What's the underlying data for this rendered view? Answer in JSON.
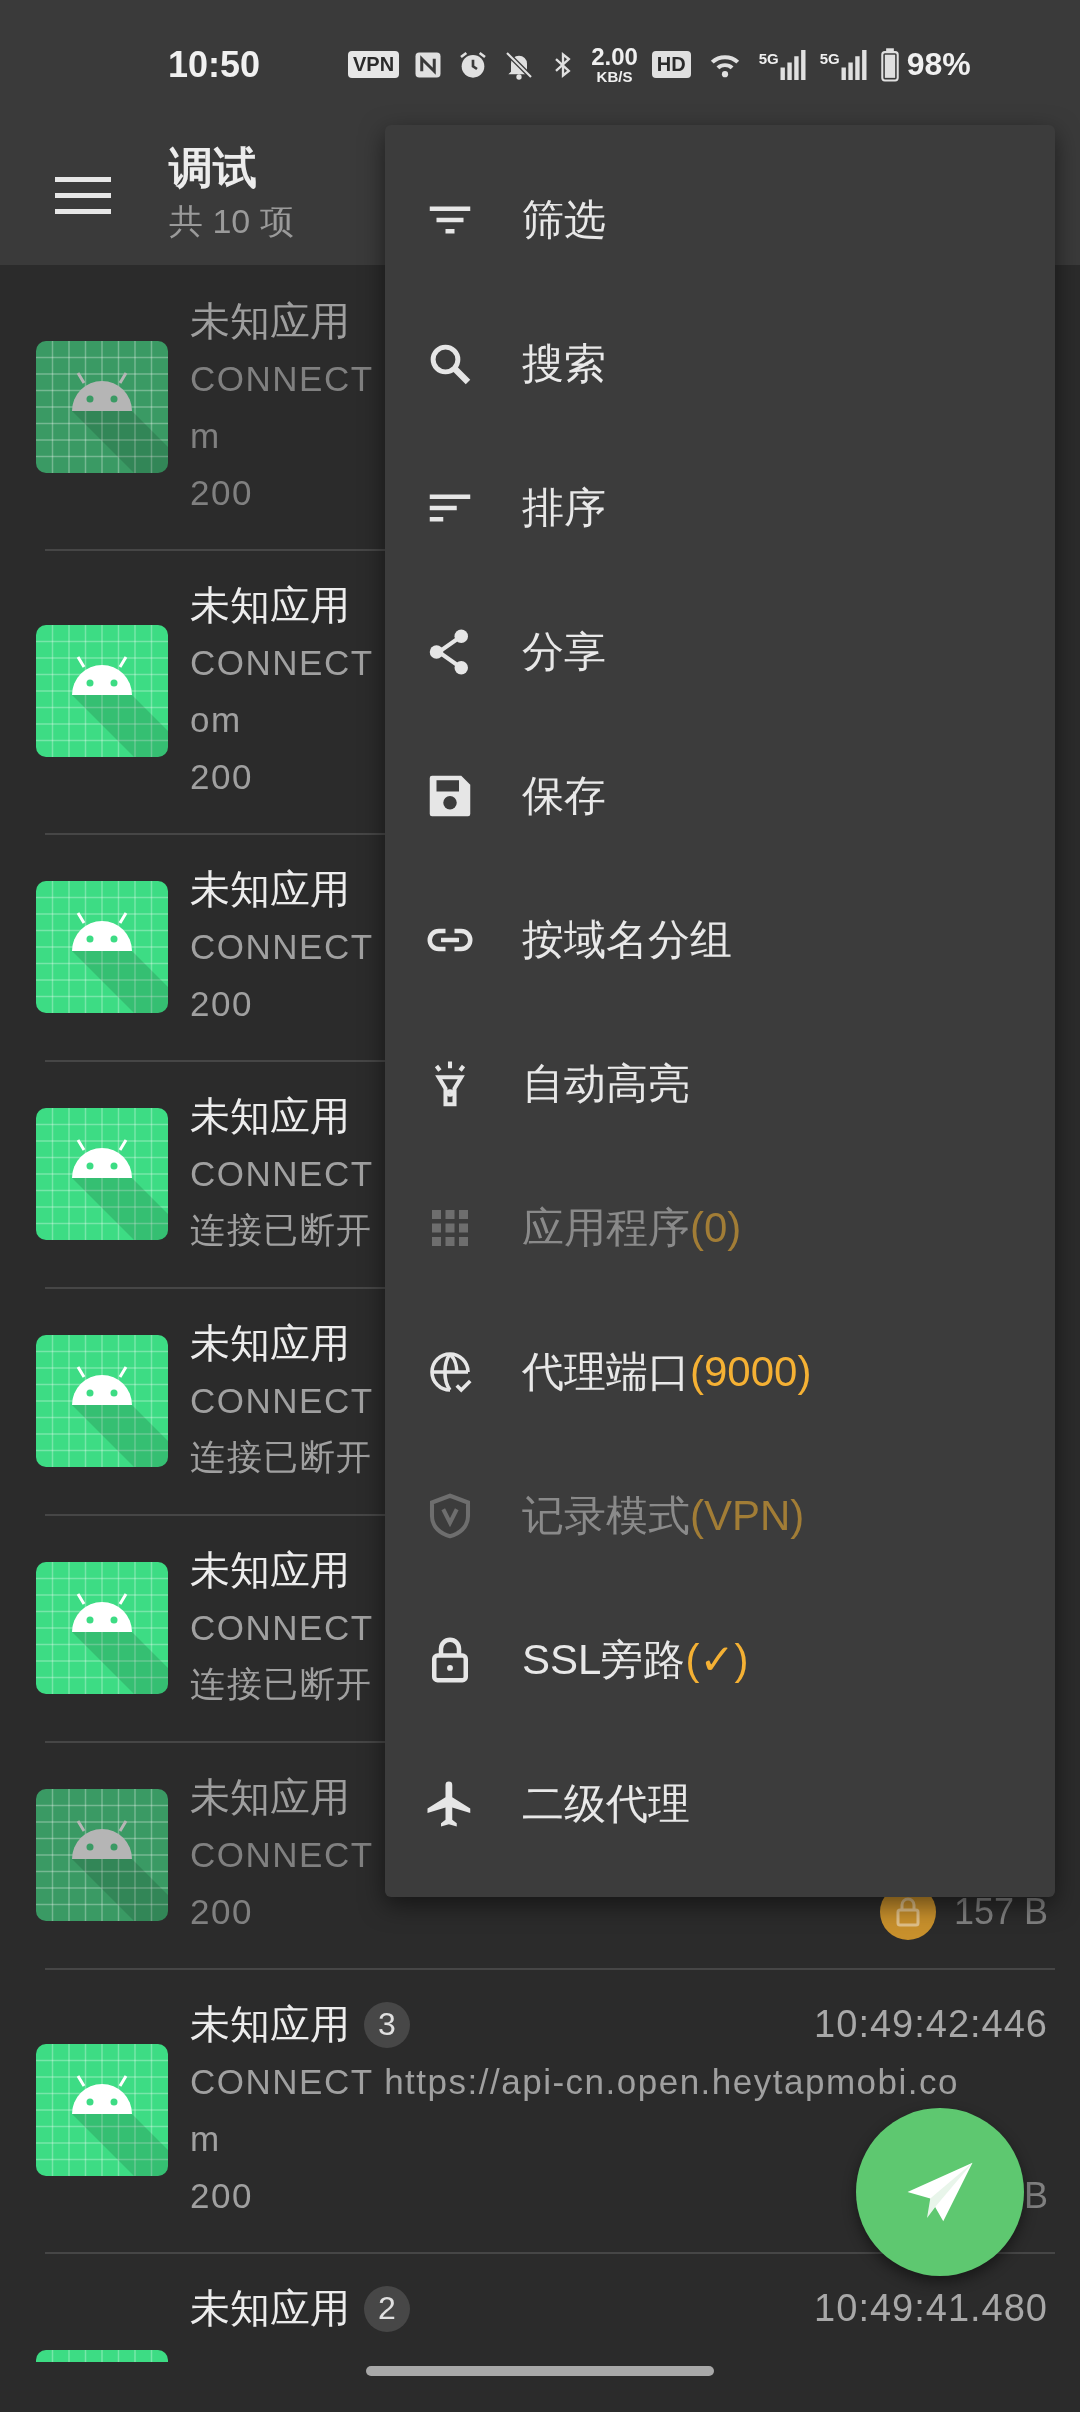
{
  "status_bar": {
    "time": "10:50",
    "vpn": "VPN",
    "speed": "2.00",
    "speed_unit": "KB/S",
    "hd": "HD",
    "networks": [
      "5G",
      "5G"
    ],
    "battery": "98%"
  },
  "app_bar": {
    "title": "调试",
    "subtitle": "共 10 项"
  },
  "rows": [
    {
      "title": "未知应用",
      "dimmed": true,
      "lines": [
        "CONNECT",
        "m",
        "200"
      ]
    },
    {
      "title": "未知应用",
      "dimmed": false,
      "lines": [
        "CONNECT",
        "om",
        "200"
      ]
    },
    {
      "title": "未知应用",
      "dimmed": false,
      "lines": [
        "CONNECT",
        "200"
      ]
    },
    {
      "title": "未知应用",
      "dimmed": false,
      "lines": [
        "CONNECT",
        "连接已断开"
      ]
    },
    {
      "title": "未知应用",
      "dimmed": false,
      "lines": [
        "CONNECT",
        "连接已断开"
      ]
    },
    {
      "title": "未知应用",
      "dimmed": false,
      "lines": [
        "CONNECT",
        "连接已断开"
      ]
    },
    {
      "title": "未知应用",
      "dimmed": true,
      "locked": true,
      "lines": [
        "CONNECT",
        "200"
      ],
      "size": "157 B"
    },
    {
      "title": "未知应用",
      "dimmed": false,
      "badge": "3",
      "time": "10:49:42:446",
      "lines": [
        "CONNECT https://api-cn.open.heytapmobi.co",
        "m",
        "200"
      ],
      "size": "B"
    },
    {
      "title": "未知应用",
      "dimmed": false,
      "badge": "2",
      "time": "10:49:41.480",
      "lines": []
    }
  ],
  "menu": [
    {
      "label": "筛选",
      "disabled": false
    },
    {
      "label": "搜索",
      "disabled": false
    },
    {
      "label": "排序",
      "disabled": false
    },
    {
      "label": "分享",
      "disabled": false
    },
    {
      "label": "保存",
      "disabled": false
    },
    {
      "label": "按域名分组",
      "disabled": false
    },
    {
      "label": "自动高亮",
      "disabled": false
    },
    {
      "label": "应用程序",
      "suffix": "(0)",
      "disabled": true
    },
    {
      "label": "代理端口",
      "suffix": "(9000)",
      "disabled": false
    },
    {
      "label": "记录模式",
      "suffix": "(VPN)",
      "disabled": true
    },
    {
      "label": "SSL旁路",
      "suffix": "(✓)",
      "disabled": false
    },
    {
      "label": "二级代理",
      "disabled": false
    }
  ]
}
